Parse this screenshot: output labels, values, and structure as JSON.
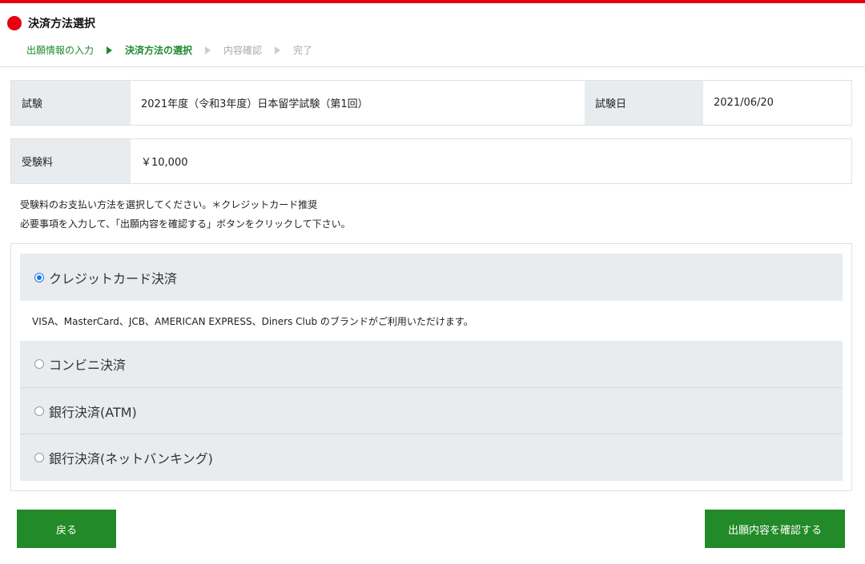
{
  "header": {
    "title": "決済方法選択",
    "steps": [
      {
        "label": "出願情報の入力"
      },
      {
        "label": "決済方法の選択"
      },
      {
        "label": "内容確認"
      },
      {
        "label": "完了"
      }
    ]
  },
  "exam": {
    "label": "試験",
    "value": "2021年度（令和3年度）日本留学試験（第1回）",
    "date_label": "試験日",
    "date_value": "2021/06/20"
  },
  "fee": {
    "label": "受験料",
    "value": "￥10,000"
  },
  "instructions": [
    "受験料のお支払い方法を選択してください。＊クレジットカード推奨",
    "必要事項を入力して、「出願内容を確認する」ボタンをクリックして下さい。"
  ],
  "payment": {
    "options": [
      {
        "label": "クレジットカード決済",
        "selected": true
      },
      {
        "label": "コンビニ決済",
        "selected": false
      },
      {
        "label": "銀行決済(ATM)",
        "selected": false
      },
      {
        "label": "銀行決済(ネットバンキング)",
        "selected": false
      }
    ],
    "credit_note": "VISA、MasterCard、JCB、AMERICAN EXPRESS、Diners Club のブランドがご利用いただけます。"
  },
  "buttons": {
    "back": "戻る",
    "confirm": "出願内容を確認する"
  },
  "colors": {
    "accent_red": "#e60012",
    "button_green": "#228a28",
    "step_green": "#1e8a2e",
    "label_bg": "#e8ecee"
  }
}
